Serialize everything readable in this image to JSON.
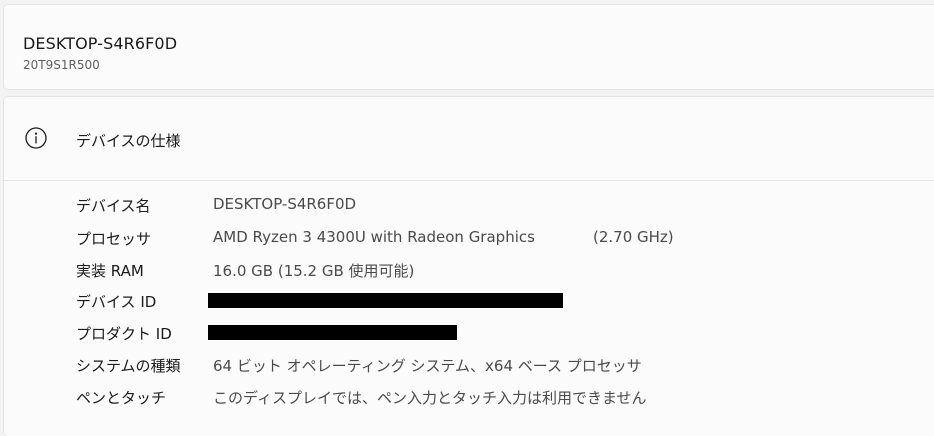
{
  "device": {
    "name": "DESKTOP-S4R6F0D",
    "model": "20T9S1R500"
  },
  "specs": {
    "title": "デバイスの仕様",
    "icon": "info-icon",
    "rows": [
      {
        "label": "デバイス名",
        "value": "DESKTOP-S4R6F0D"
      },
      {
        "label": "プロセッサ",
        "value": "AMD Ryzen 3 4300U with Radeon Graphics",
        "extra": "(2.70 GHz)"
      },
      {
        "label": "実装 RAM",
        "value": "16.0 GB (15.2 GB 使用可能)"
      },
      {
        "label": "デバイス ID",
        "value_redacted": true
      },
      {
        "label": "プロダクト ID",
        "value_redacted": true
      },
      {
        "label": "システムの種類",
        "value": "64 ビット オペレーティング システム、x64 ベース プロセッサ"
      },
      {
        "label": "ペンとタッチ",
        "value": "このディスプレイでは、ペン入力とタッチ入力は利用できません"
      }
    ]
  }
}
